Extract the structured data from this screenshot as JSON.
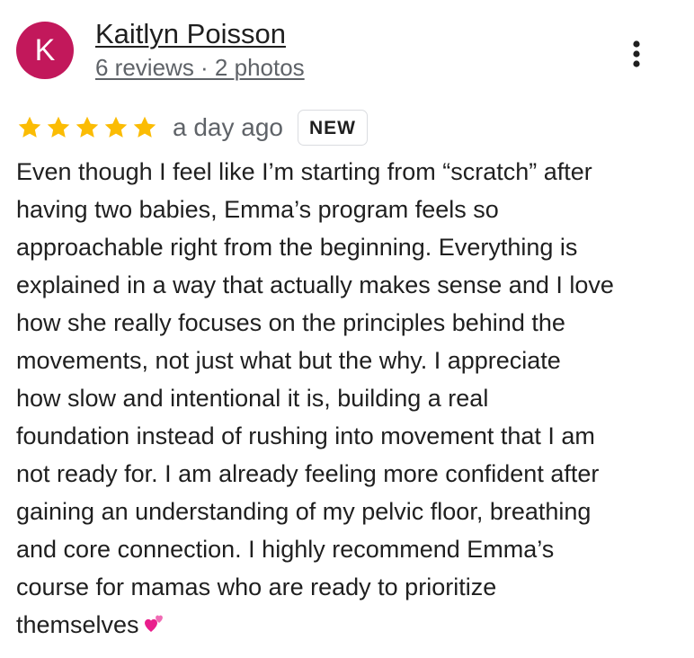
{
  "reviewer": {
    "avatar_initial": "K",
    "name": "Kaitlyn Poisson",
    "meta": "6 reviews · 2 photos",
    "avatar_color": "#c2185b"
  },
  "more_menu": {
    "icon": "more-vert-icon"
  },
  "rating": {
    "stars": 5,
    "max_stars": 5,
    "star_color": "#fbbc04",
    "time_ago": "a day ago",
    "badge": "NEW"
  },
  "review": {
    "lines": [
      "Even though I feel like I’m starting from “scratch” after",
      "having two babies, Emma’s program feels so",
      "approachable right from the beginning. Everything is",
      "explained in a way that actually makes sense and I love",
      "how she really focuses on the principles behind the",
      "movements, not just what but the why. I appreciate",
      "how slow and intentional it is, building a real",
      "foundation instead of rushing into movement that I am",
      "not ready for. I am already feeling more confident after",
      "gaining an understanding of my pelvic floor, breathing",
      "and core connection. I highly recommend Emma’s",
      "course for mamas who are ready to prioritize",
      "themselves"
    ],
    "trailing_emoji": "two-hearts-emoji"
  }
}
